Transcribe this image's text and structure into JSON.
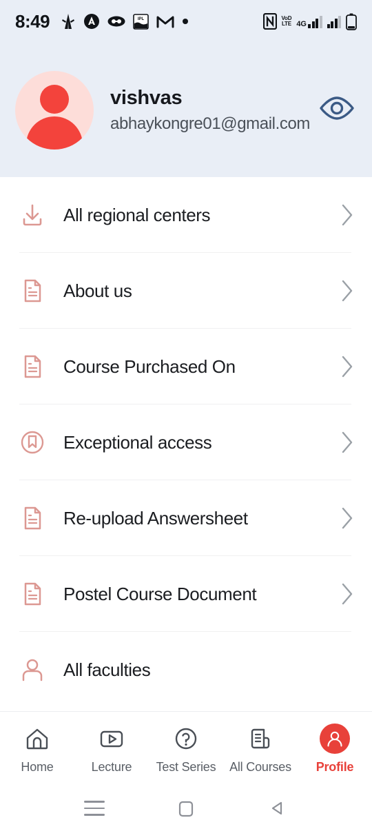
{
  "status_bar": {
    "time": "8:49",
    "left_icons": [
      "person-notification-icon",
      "circle-a-icon",
      "oval-glasses-icon",
      "ipl-cricket-icon",
      "gmail-icon",
      "dot-icon"
    ],
    "right_icons": [
      "nfc-icon",
      "volte-icon",
      "signal-4g-icon",
      "signal-icon",
      "battery-icon"
    ],
    "volte_top": "VoD",
    "volte_bottom": "LTE",
    "network": "4G"
  },
  "profile": {
    "name": "vishvas",
    "email": "abhaykongre01@gmail.com",
    "avatar_icon": "user-avatar-icon",
    "eye_icon": "eye-icon",
    "avatar_bg": "#fdddd9",
    "avatar_fg": "#f3433c",
    "eye_color": "#3b5a85",
    "header_bg": "#e9eef6"
  },
  "menu": {
    "items": [
      {
        "label": "All regional centers",
        "icon": "download-icon",
        "chevron": true
      },
      {
        "label": "About us",
        "icon": "document-icon",
        "chevron": true
      },
      {
        "label": "Course Purchased On",
        "icon": "document-icon",
        "chevron": true
      },
      {
        "label": "Exceptional access",
        "icon": "badge-bookmark-icon",
        "chevron": true
      },
      {
        "label": "Re-upload Answersheet",
        "icon": "document-icon",
        "chevron": true
      },
      {
        "label": "Postel Course Document",
        "icon": "document-icon",
        "chevron": true
      },
      {
        "label": "All faculties",
        "icon": "person-icon",
        "chevron": false
      }
    ],
    "icon_color": "#dc9892",
    "chevron_color": "#9aa0a6",
    "divider_color": "#f0f0f1"
  },
  "bottom_nav": {
    "active_color": "#e8413a",
    "inactive_color": "#5a5f66",
    "items": [
      {
        "label": "Home",
        "icon": "home-icon",
        "active": false
      },
      {
        "label": "Lecture",
        "icon": "video-play-icon",
        "active": false
      },
      {
        "label": "Test Series",
        "icon": "question-circle-icon",
        "active": false
      },
      {
        "label": "All Courses",
        "icon": "scroll-document-icon",
        "active": false
      },
      {
        "label": "Profile",
        "icon": "profile-avatar-icon",
        "active": true
      }
    ]
  },
  "system_nav": {
    "items": [
      {
        "icon": "recents-menu-icon"
      },
      {
        "icon": "home-square-icon"
      },
      {
        "icon": "back-triangle-icon"
      }
    ]
  }
}
